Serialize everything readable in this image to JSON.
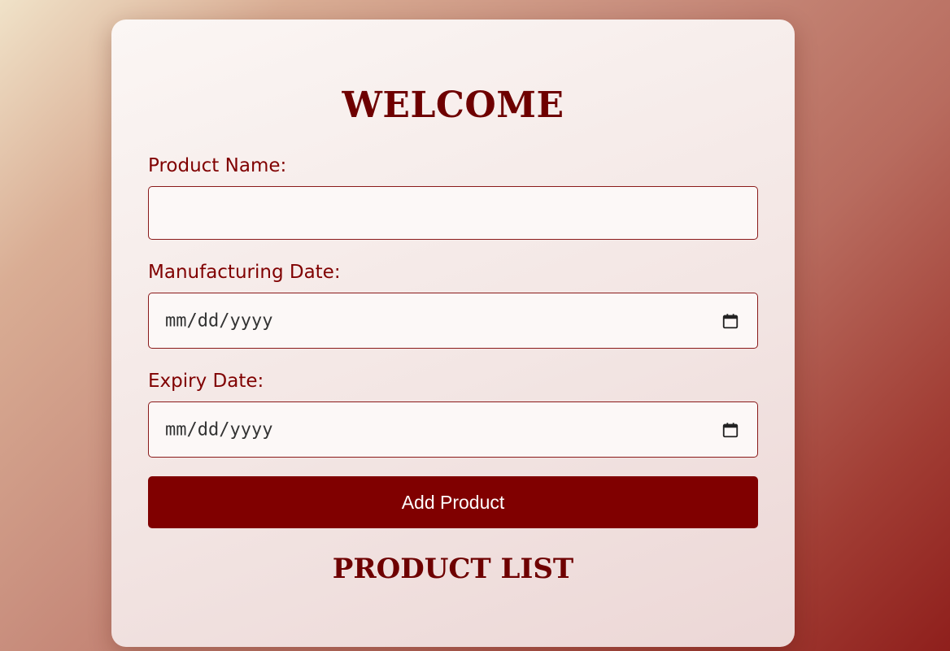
{
  "form": {
    "title": "WELCOME",
    "product_name": {
      "label": "Product Name:",
      "value": ""
    },
    "manufacturing_date": {
      "label": "Manufacturing Date:",
      "placeholder": "mm/dd/yyyy"
    },
    "expiry_date": {
      "label": "Expiry Date:",
      "placeholder": "mm/dd/yyyy"
    },
    "submit_label": "Add Product"
  },
  "list": {
    "title": "PRODUCT LIST"
  },
  "colors": {
    "accent": "#800000",
    "heading": "#6e0000"
  },
  "icons": {
    "date_picker": "calendar-icon"
  }
}
